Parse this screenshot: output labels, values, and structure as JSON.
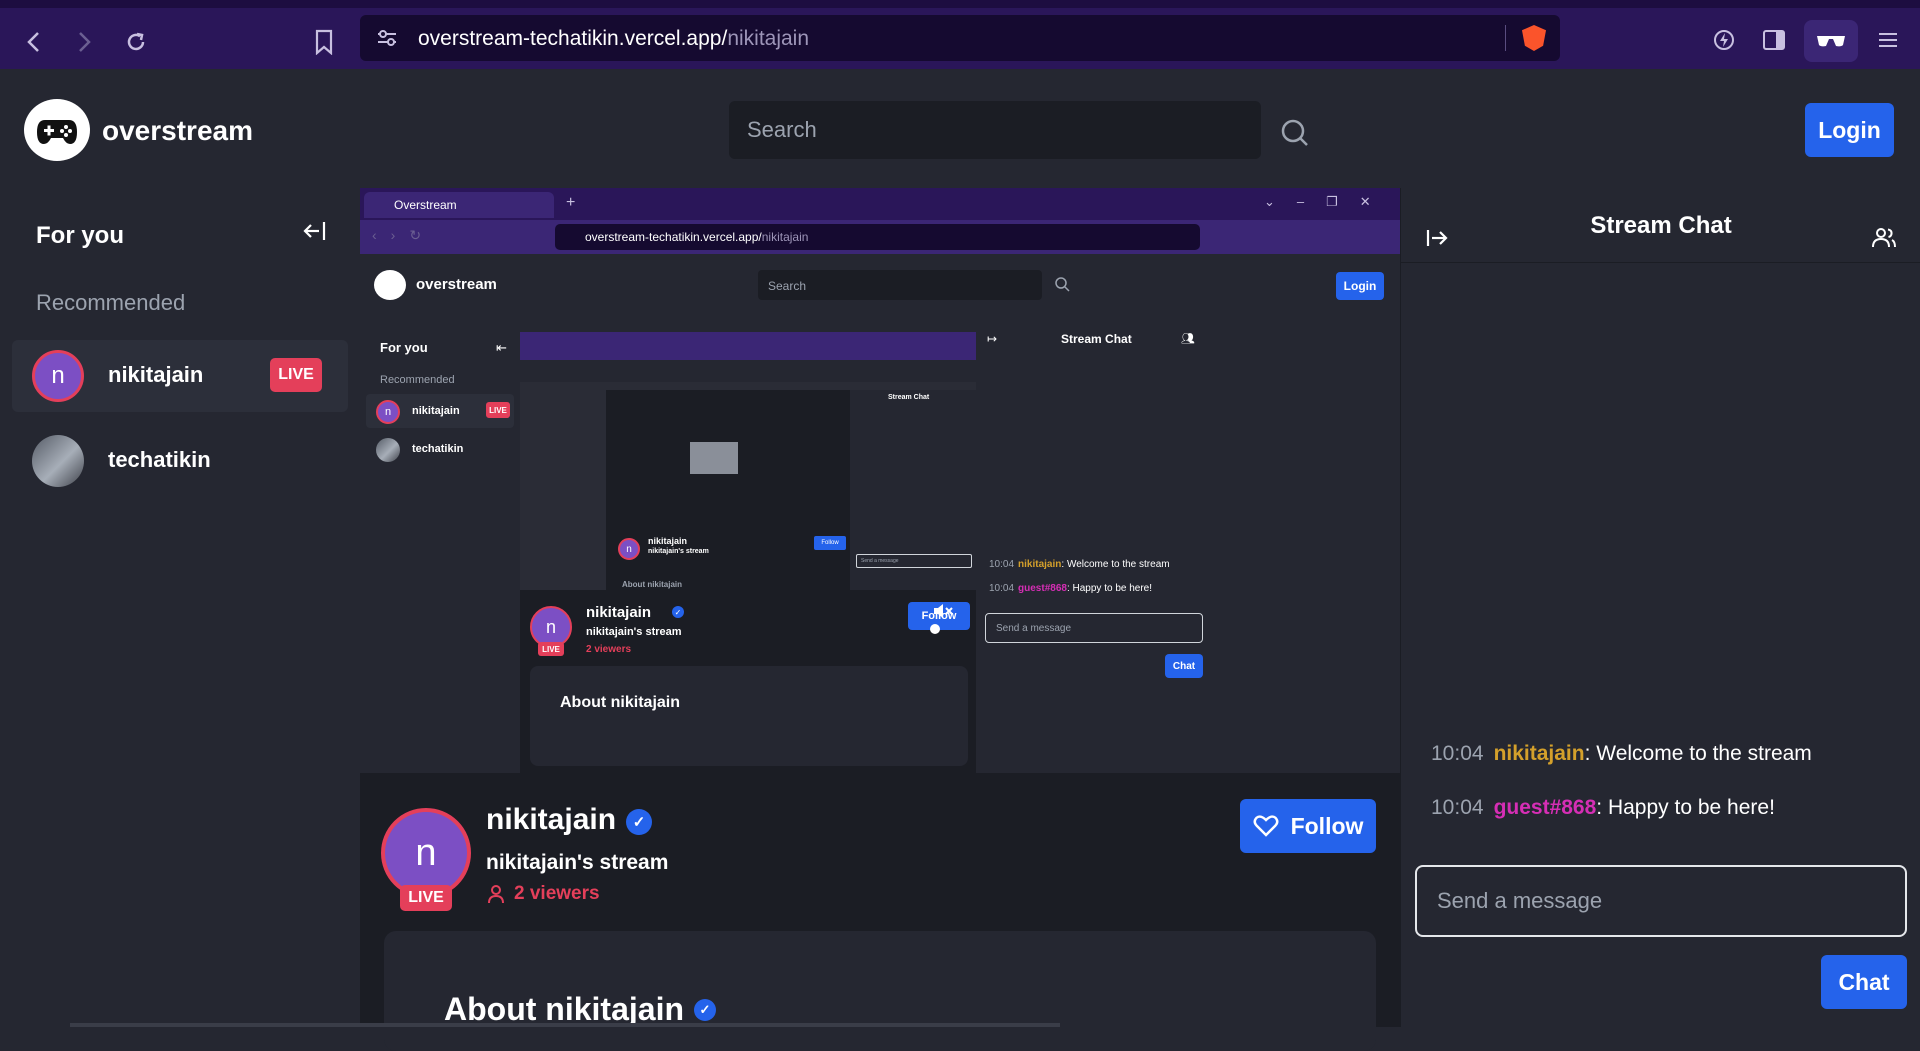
{
  "browser": {
    "url_host": "overstream-techatikin.vercel.app/",
    "url_path": "nikitajain",
    "icons": [
      "back-icon",
      "forward-icon",
      "reload-icon",
      "bookmark-icon",
      "site-settings-icon",
      "brave-icon",
      "leo-icon",
      "sidebar-icon",
      "private-icon",
      "menu-icon"
    ]
  },
  "header": {
    "app_name": "overstream",
    "search_placeholder": "Search",
    "login_label": "Login"
  },
  "sidebar": {
    "title": "For you",
    "section": "Recommended",
    "items": [
      {
        "name": "nikitajain",
        "initial": "n",
        "live": true,
        "live_label": "LIVE"
      },
      {
        "name": "techatikin",
        "live": false
      }
    ]
  },
  "nested": {
    "tab_title": "Overstream",
    "url_host": "overstream-techatikin.vercel.app/",
    "url_path": "nikitajain",
    "app_name": "overstream",
    "search_placeholder": "Search",
    "login_label": "Login",
    "sidebar_title": "For you",
    "section": "Recommended",
    "item1": "nikitajain",
    "item1_live": "LIVE",
    "item2": "techatikin",
    "chat_title": "Stream Chat",
    "msg1_time": "10:04",
    "msg1_user": "nikitajain",
    "msg1_text": ": Welcome to the stream",
    "msg2_time": "10:04",
    "msg2_user": "guest#868",
    "msg2_text": ": Happy to be here!",
    "send_placeholder": "Send a message",
    "chat_label": "Chat",
    "streamer_name": "nikitajain",
    "stream_title": "nikitajain's stream",
    "viewers": "2 viewers",
    "follow_label": "Follow",
    "about_title": "About nikitajain",
    "live_label": "LIVE",
    "initial": "n"
  },
  "streamer": {
    "initial": "n",
    "live_label": "LIVE",
    "name": "nikitajain",
    "stream_title": "nikitajain's stream",
    "viewers": "2 viewers",
    "follow_label": "Follow",
    "about_title": "About nikitajain"
  },
  "chat": {
    "title": "Stream Chat",
    "messages": [
      {
        "time": "10:04",
        "user": "nikitajain",
        "text": ": Welcome to the stream"
      },
      {
        "time": "10:04",
        "user": "guest#868",
        "text": ": Happy to be here!"
      }
    ],
    "input_placeholder": "Send a message",
    "send_label": "Chat"
  },
  "colors": {
    "accent": "#2563eb",
    "live": "#e43f5a",
    "browser_bar": "#2a1659",
    "username_streamer": "#d4a02b",
    "username_guest": "#d62eb5"
  }
}
